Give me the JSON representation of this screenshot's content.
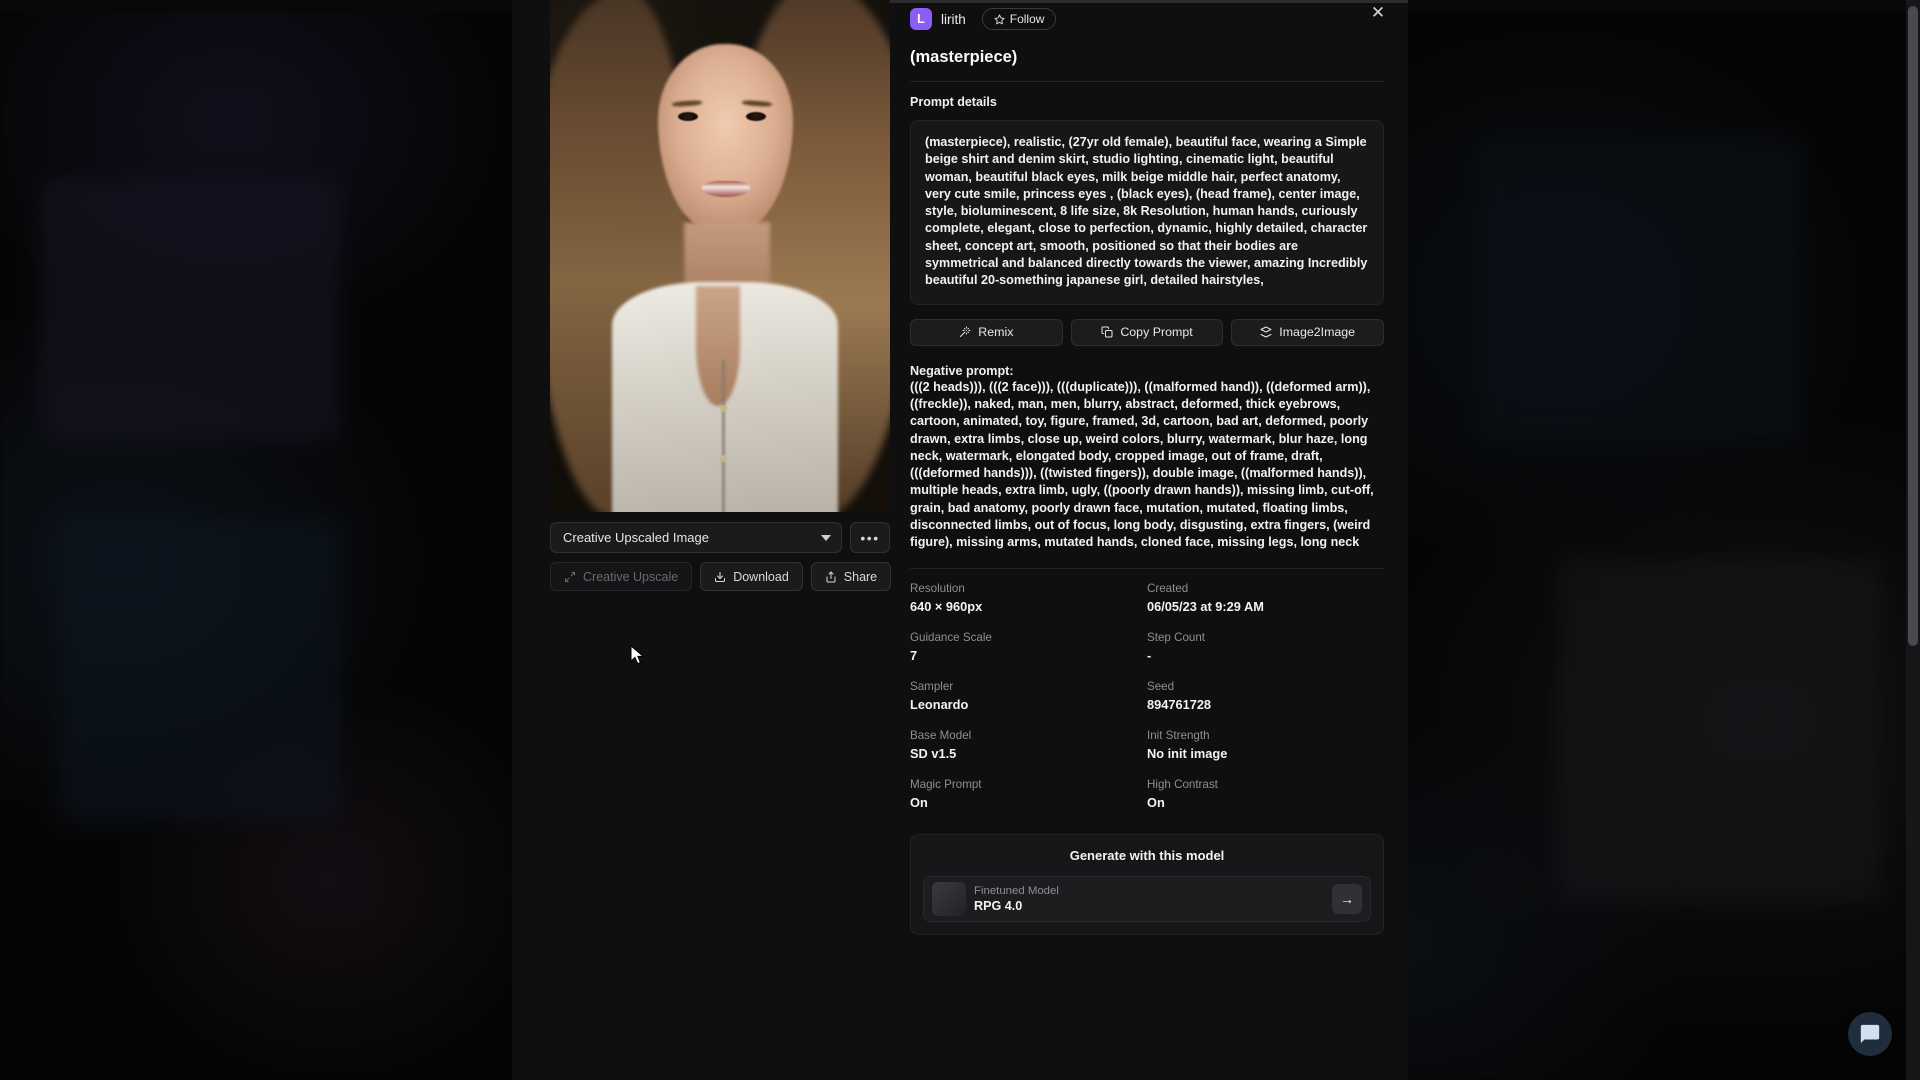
{
  "user": {
    "avatar_initial": "L",
    "username": "lirith",
    "follow_label": "Follow"
  },
  "modal": {
    "close_label": "✕",
    "title": "(masterpiece)",
    "prev_label": "←",
    "next_label": "→"
  },
  "prompt": {
    "section_label": "Prompt details",
    "text": "(masterpiece), realistic, (27yr old female), beautiful face, wearing a Simple beige shirt and denim skirt, studio lighting, cinematic light, beautiful woman, beautiful black eyes, milk beige middle hair, perfect anatomy, very cute smile, princess eyes , (black eyes), (head frame), center image, style, bioluminescent, 8 life size, 8k Resolution, human hands, curiously complete, elegant, close to perfection, dynamic, highly detailed, character sheet, concept art, smooth, positioned so that their bodies are symmetrical and balanced directly towards the viewer, amazing Incredibly beautiful 20-something japanese girl, detailed hairstyles,"
  },
  "actions": {
    "remix": "Remix",
    "copy_prompt": "Copy Prompt",
    "image2image": "Image2Image"
  },
  "negative": {
    "label": "Negative prompt:",
    "text": "(((2 heads))), (((2 face))), (((duplicate))), ((malformed hand)), ((deformed arm)), ((freckle)), naked, man, men, blurry, abstract, deformed, thick eyebrows, cartoon, animated, toy, figure, framed, 3d, cartoon, bad art, deformed, poorly drawn, extra limbs, close up, weird colors, blurry, watermark, blur haze, long neck, watermark, elongated body, cropped image, out of frame, draft, (((deformed hands))), ((twisted fingers)), double image, ((malformed hands)), multiple heads, extra limb, ugly, ((poorly drawn hands)), missing limb, cut-off, grain, bad anatomy, poorly drawn face, mutation, mutated, floating limbs, disconnected limbs, out of focus, long body, disgusting, extra fingers, (weird figure), missing arms, mutated hands, cloned face, missing legs, long neck"
  },
  "image_controls": {
    "upscale_option": "Creative Upscaled Image",
    "more_label": "•••",
    "creative_upscale": "Creative Upscale",
    "download": "Download",
    "share": "Share"
  },
  "metadata": [
    {
      "key": "Resolution",
      "value": "640 × 960px"
    },
    {
      "key": "Created",
      "value": "06/05/23 at 9:29 AM"
    },
    {
      "key": "Guidance Scale",
      "value": "7"
    },
    {
      "key": "Step Count",
      "value": "-"
    },
    {
      "key": "Sampler",
      "value": "Leonardo"
    },
    {
      "key": "Seed",
      "value": "894761728"
    },
    {
      "key": "Base Model",
      "value": "SD v1.5"
    },
    {
      "key": "Init Strength",
      "value": "No init image"
    },
    {
      "key": "Magic Prompt",
      "value": "On"
    },
    {
      "key": "High Contrast",
      "value": "On"
    }
  ],
  "generate": {
    "title": "Generate with this model",
    "model_key": "Finetuned Model",
    "model_value": "RPG 4.0",
    "go_label": "→"
  },
  "colors": {
    "accent": "#8b5cf6",
    "panel_bg": "#0f0f10",
    "prompt_bg": "#171719",
    "text": "#f2f2f4",
    "muted": "#8e8e93"
  }
}
